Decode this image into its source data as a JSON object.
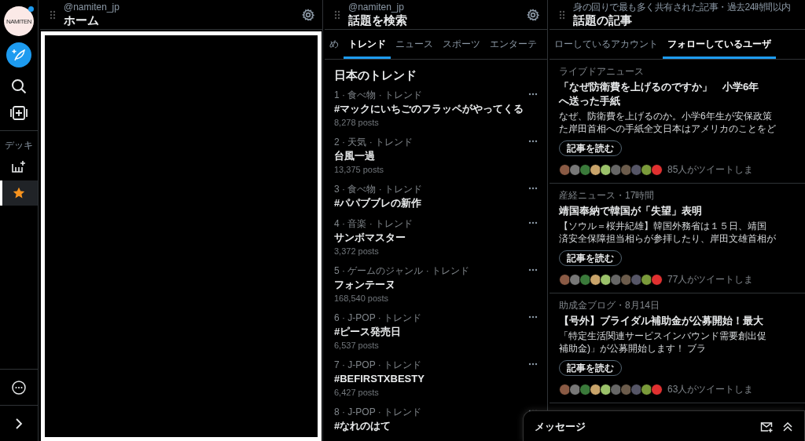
{
  "sidebar": {
    "logo_text": "NAMITEN",
    "has_notification": true,
    "section_label": "デッキ",
    "deck_items": [
      {
        "kind": "add-column",
        "selected": false
      },
      {
        "kind": "favorites",
        "selected": true
      }
    ]
  },
  "columns": [
    {
      "kind": "home",
      "account": "@namiten_jp",
      "title": "ホーム",
      "settings": true
    },
    {
      "kind": "explore",
      "account": "@namiten_jp",
      "title": "話題を検索",
      "settings": true,
      "tabs": [
        {
          "label": "め",
          "selected": false
        },
        {
          "label": "トレンド",
          "selected": true
        },
        {
          "label": "ニュース",
          "selected": false
        },
        {
          "label": "スポーツ",
          "selected": false
        },
        {
          "label": "エンターテ",
          "selected": false
        }
      ],
      "section_title": "日本のトレンド",
      "trends": [
        {
          "meta": "1 · 食べ物 · トレンド",
          "topic": "#マックにいちごのフラッペがやってくる",
          "posts": "8,278 posts"
        },
        {
          "meta": "2 · 天気 · トレンド",
          "topic": "台風一過",
          "posts": "13,375 posts"
        },
        {
          "meta": "3 · 食べ物 · トレンド",
          "topic": "#パパブブレの新作"
        },
        {
          "meta": "4 · 音楽 · トレンド",
          "topic": "サンボマスター",
          "posts": "3,372 posts"
        },
        {
          "meta": "5 · ゲームのジャンル · トレンド",
          "topic": "フォンテーヌ",
          "posts": "168,540 posts"
        },
        {
          "meta": "6 · J-POP · トレンド",
          "topic": "#ピース発売日",
          "posts": "6,537 posts"
        },
        {
          "meta": "7 · J-POP · トレンド",
          "topic": "#BEFIRSTXBESTY",
          "posts": "6,427 posts"
        },
        {
          "meta": "8 · J-POP · トレンド",
          "topic": "#なれのはて"
        }
      ]
    },
    {
      "kind": "articles",
      "subtitle": "身の回りで最も多く共有された記事・過去24時間以内",
      "title": "話題の記事",
      "settings": false,
      "tabs": [
        {
          "label": "ローしているアカウント",
          "selected": false
        },
        {
          "label": "フォローしているユーザ",
          "selected": true
        }
      ],
      "articles": [
        {
          "source": "ライブドアニュース",
          "title_lines": [
            "「なぜ防衛費を上げるのですか」　小学6年",
            "へ送った手紙"
          ],
          "summary_lines": [
            "なぜ、防衛費を上げるのか。小学6年生が安保政策",
            "た岸田首相への手紙全文日本はアメリカのことをど"
          ],
          "button": "記事を読む",
          "tweets": "85人がツイートしま"
        },
        {
          "source": "産経ニュース・17時間",
          "title_lines": [
            "靖国奉納で韓国が「失望」表明"
          ],
          "summary_lines": [
            "【ソウル＝桜井紀雄】韓国外務省は１５日、靖国",
            "済安全保障担当相らが参拝したり、岸田文雄首相が"
          ],
          "button": "記事を読む",
          "tweets": "77人がツイートしま"
        },
        {
          "source": "助成金ブログ・8月14日",
          "title_lines": [
            "【号外】ブライダル補助金が公募開始！最大"
          ],
          "summary_lines": [
            "「特定生活関連サービスインバウンド需要創出促",
            "補助金)」が公募開始します！ ブラ"
          ],
          "button": "記事を読む",
          "tweets": "63人がツイートしま"
        }
      ]
    }
  ],
  "messages": {
    "title": "メッセージ"
  }
}
